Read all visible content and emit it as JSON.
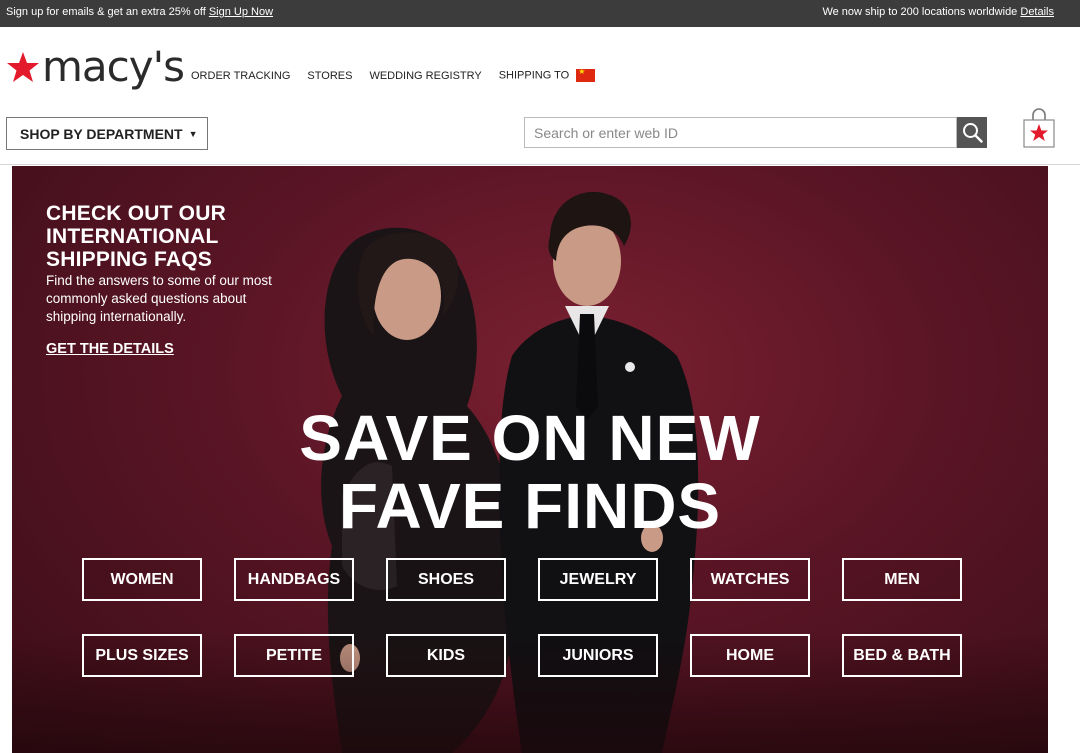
{
  "promo": {
    "left_text": "Sign up for emails & get an extra 25% off",
    "left_link": "Sign Up Now",
    "right_text": "We now ship to 200 locations worldwide",
    "right_link": "Details"
  },
  "brand": {
    "logo_text": "macy's",
    "logo_star": "star-icon",
    "accent_color": "#e21a2c"
  },
  "top_nav": {
    "items": [
      "ORDER TRACKING",
      "STORES",
      "WEDDING REGISTRY",
      "SHIPPING TO"
    ],
    "shipping_flag": "china-flag-icon"
  },
  "department": {
    "label": "SHOP BY DEPARTMENT",
    "caret": "▼"
  },
  "search": {
    "placeholder": "Search or enter web ID",
    "value": "",
    "icon": "search-icon"
  },
  "bag": {
    "icon": "shopping-bag-icon"
  },
  "hero": {
    "faq_title": "CHECK OUT OUR\nINTERNATIONAL\nSHIPPING FAQS",
    "faq_body": "Find the answers to some of our most commonly asked questions about shipping internationally.",
    "faq_link": "GET THE DETAILS",
    "headline_line1": "SAVE ON NEW",
    "headline_line2": "FAVE FINDS",
    "background_color": "#5a1525",
    "categories": [
      "WOMEN",
      "HANDBAGS",
      "SHOES",
      "JEWELRY",
      "WATCHES",
      "MEN",
      "PLUS SIZES",
      "PETITE",
      "KIDS",
      "JUNIORS",
      "HOME",
      "BED & BATH"
    ]
  }
}
